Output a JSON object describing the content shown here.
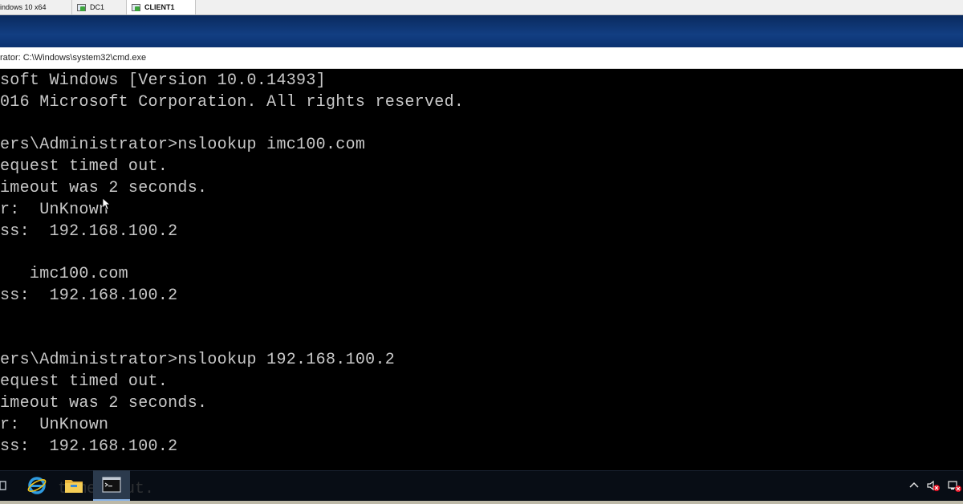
{
  "vm_tabs": [
    {
      "label": "indows 10 x64"
    },
    {
      "label": "DC1"
    },
    {
      "label": "CLIENT1"
    }
  ],
  "cmd_window": {
    "title": "rator: C:\\Windows\\system32\\cmd.exe"
  },
  "console": {
    "lines": [
      "soft Windows [Version 10.0.14393]",
      "016 Microsoft Corporation. All rights reserved.",
      "",
      "ers\\Administrator>nslookup imc100.com",
      "equest timed out.",
      "imeout was 2 seconds.",
      "r:  UnKnown",
      "ss:  192.168.100.2",
      "",
      "   imc100.com",
      "ss:  192.168.100.2",
      "",
      "",
      "ers\\Administrator>nslookup 192.168.100.2",
      "equest timed out.",
      "imeout was 2 seconds.",
      "r:  UnKnown",
      "ss:  192.168.100.2"
    ],
    "ghost_line": "      timed out."
  },
  "taskbar": {
    "items": [
      "ie-icon",
      "file-explorer-icon",
      "cmd-icon"
    ]
  },
  "tray": {
    "icons": [
      "chevron-up-icon",
      "speaker-muted-icon",
      "network-icon"
    ]
  },
  "colors": {
    "console_bg": "#000000",
    "console_text": "#c8c8c8",
    "desktop_blue": "#123e82"
  }
}
